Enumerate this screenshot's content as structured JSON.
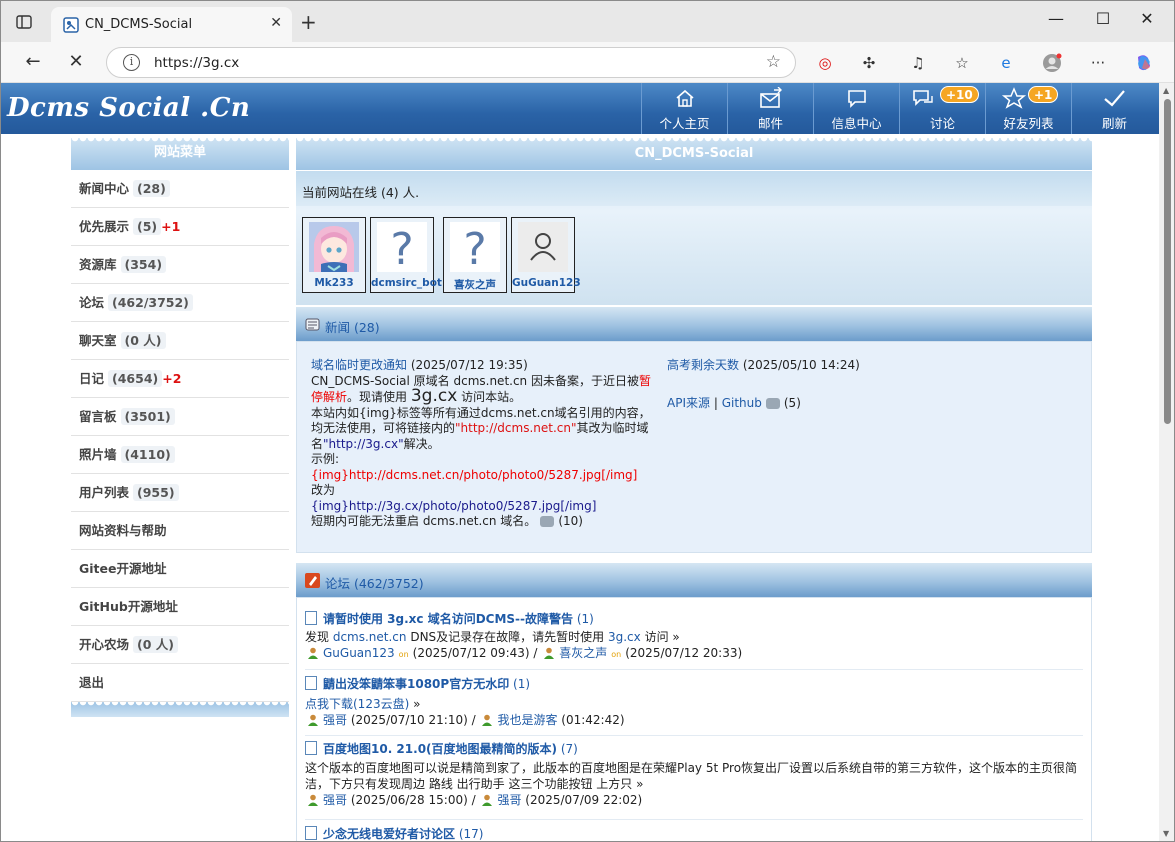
{
  "browser": {
    "tab_title": "CN_DCMS-Social",
    "url": "https://3g.cx"
  },
  "header": {
    "logo": "Dcms Social .Cn",
    "nav": [
      {
        "label": "个人主页",
        "icon": "home-icon"
      },
      {
        "label": "邮件",
        "icon": "mail-icon"
      },
      {
        "label": "信息中心",
        "icon": "message-icon"
      },
      {
        "label": "讨论",
        "icon": "chat-icon",
        "badge": "+10"
      },
      {
        "label": "好友列表",
        "icon": "star-icon",
        "badge": "+1"
      },
      {
        "label": "刷新",
        "icon": "check-icon"
      }
    ]
  },
  "menu": {
    "title": "网站菜单",
    "items": [
      {
        "label": "新闻中心",
        "count": "(28)"
      },
      {
        "label": "优先展示",
        "count": "(5)",
        "plus": "+1"
      },
      {
        "label": "资源库",
        "count": "(354)"
      },
      {
        "label": "论坛",
        "count": "(462/3752)"
      },
      {
        "label": "聊天室",
        "count": "(0 人)"
      },
      {
        "label": "日记",
        "count": "(4654)",
        "plus": "+2"
      },
      {
        "label": "留言板",
        "count": "(3501)"
      },
      {
        "label": "照片墙",
        "count": "(4110)"
      },
      {
        "label": "用户列表",
        "count": "(955)"
      },
      {
        "label": "网站资料与帮助"
      },
      {
        "label": "Gitee开源地址"
      },
      {
        "label": "GitHub开源地址"
      },
      {
        "label": "开心农场",
        "count": "(0 人)"
      },
      {
        "label": "退出"
      }
    ]
  },
  "main": {
    "title": "CN_DCMS-Social",
    "online_text": "当前网站在线 (4) 人.",
    "online_users": [
      "Mk233",
      "dcmsirc_bot",
      "喜灰之声",
      "GuGuan123"
    ]
  },
  "news": {
    "heading": "新闻 (28)",
    "left": {
      "title": "域名临时更改通知",
      "date": "(2025/07/12 19:35)",
      "line1": "CN_DCMS-Social 原域名 dcms.net.cn 因未备案，于近日被",
      "red1": "暂停解析",
      "line2": "。现请使用 ",
      "big": "3g.cx",
      "line3": " 访问本站。",
      "line4": "本站内如{img}标签等所有通过dcms.net.cn域名引用的内容，均无法使用，可将链接内的",
      "red2": "\"http://dcms.net.cn\"",
      "line5": "其改为临时域名",
      "navy1": "\"http://3g.cx\"",
      "line6": "解决。",
      "example": "示例:",
      "red3": "{img}http://dcms.net.cn/photo/photo0/5287.jpg[/img]",
      "change": "改为",
      "navy2": "{img}http://3g.cx/photo/photo0/5287.jpg[/img]",
      "last": "短期内可能无法重启 dcms.net.cn 域名。",
      "comments": "(10)"
    },
    "right": {
      "title": "高考剩余天数",
      "date": "(2025/05/10 14:24)",
      "api": "API来源",
      "sep": "|",
      "github": "Github",
      "comments": "(5)"
    }
  },
  "forum": {
    "heading": "论坛 (462/3752)",
    "posts": [
      {
        "title": "请暂时使用 3g.xc 域名访问DCMS--故障警告",
        "count": "(1)",
        "desc_pre": "发现 ",
        "desc_link": "dcms.net.cn",
        "desc_mid": " DNS及记录存在故障，请先暂时使用 ",
        "desc_link2": "3g.cx",
        "desc_post": " 访问 »",
        "author": "GuGuan123",
        "on1": "on",
        "date": "(2025/07/12 09:43) /",
        "reply_user": "喜灰之声",
        "on2": "on",
        "reply_date": "(2025/07/12 20:33)"
      },
      {
        "title": "鼱出没笨鼱笨事1080P官方无水印",
        "count": "(1)",
        "desc_link": "点我下载(123云盘)",
        "desc_post": " »",
        "author": "强哥",
        "date": "(2025/07/10 21:10) /",
        "reply_user": "我也是游客",
        "reply_date": "(01:42:42)"
      },
      {
        "title": "百度地图10. 21.0(百度地图最精简的版本)",
        "count": "(7)",
        "desc": "这个版本的百度地图可以说是精简到家了，此版本的百度地图是在荣耀Play 5t Pro恢复出厂设置以后系统自带的第三方软件，这个版本的主页很简洁，下方只有发现周边 路线 出行助手 这三个功能按钮 上方只 »",
        "author": "强哥",
        "date": "(2025/06/28 15:00) /",
        "reply_user": "强哥",
        "reply_date": "(2025/07/09 22:02)"
      },
      {
        "title": "少念无线电爱好者讨论区",
        "count": "(17)"
      }
    ]
  }
}
